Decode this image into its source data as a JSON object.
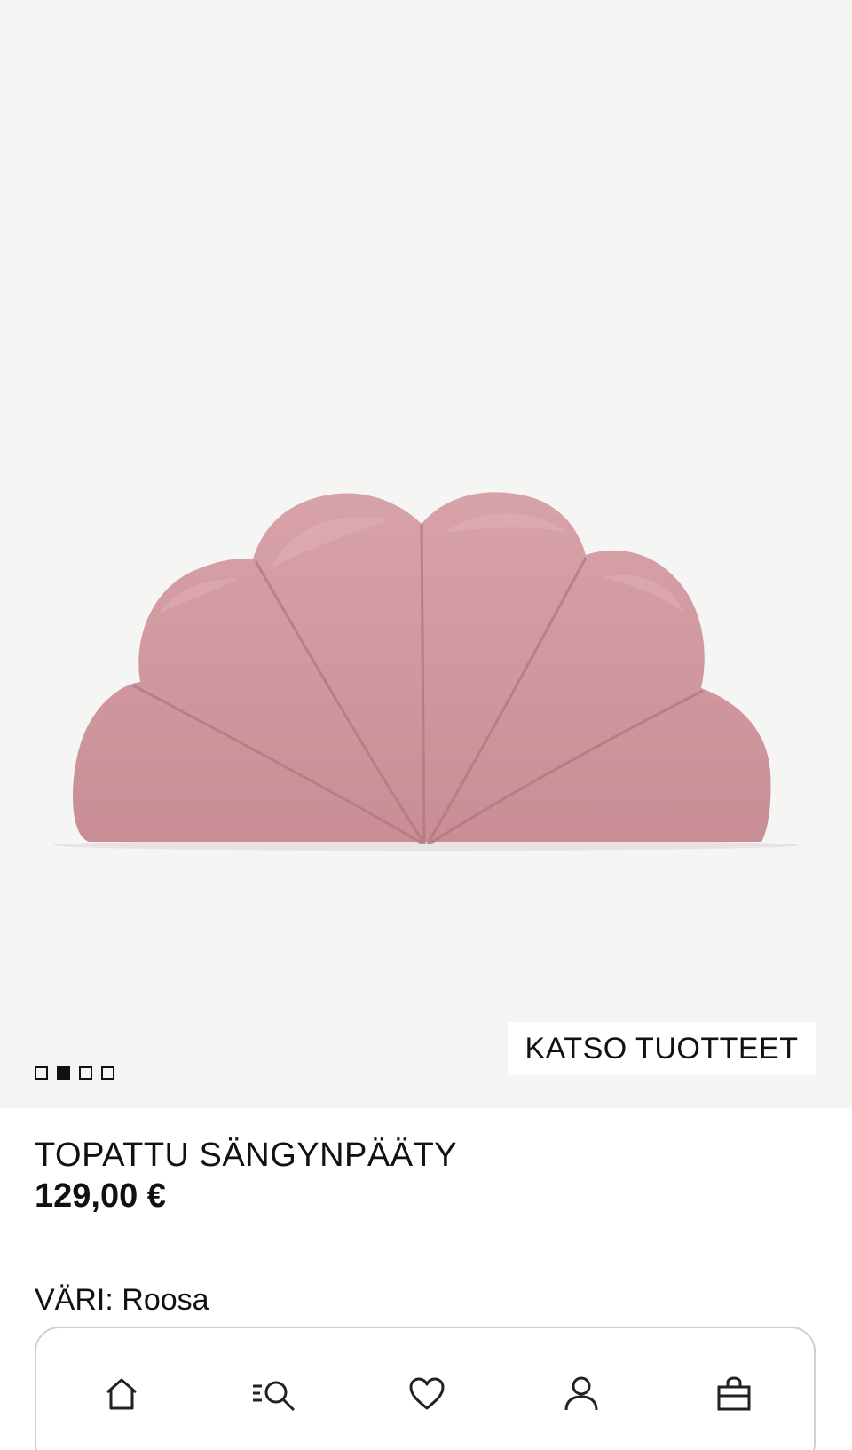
{
  "hero": {
    "carousel": {
      "count": 4,
      "active_index": 1
    },
    "cta_label": "KATSO TUOTTEET",
    "product_color": "#d19aa0"
  },
  "product": {
    "title": "TOPATTU SÄNGYNPÄÄTY",
    "price": "129,00 €",
    "color_label": "VÄRI:",
    "color_value": "Roosa"
  },
  "bottom_nav": {
    "items": [
      {
        "icon": "home-icon"
      },
      {
        "icon": "search-menu-icon"
      },
      {
        "icon": "heart-icon"
      },
      {
        "icon": "account-icon"
      },
      {
        "icon": "shopping-bag-icon"
      }
    ]
  }
}
